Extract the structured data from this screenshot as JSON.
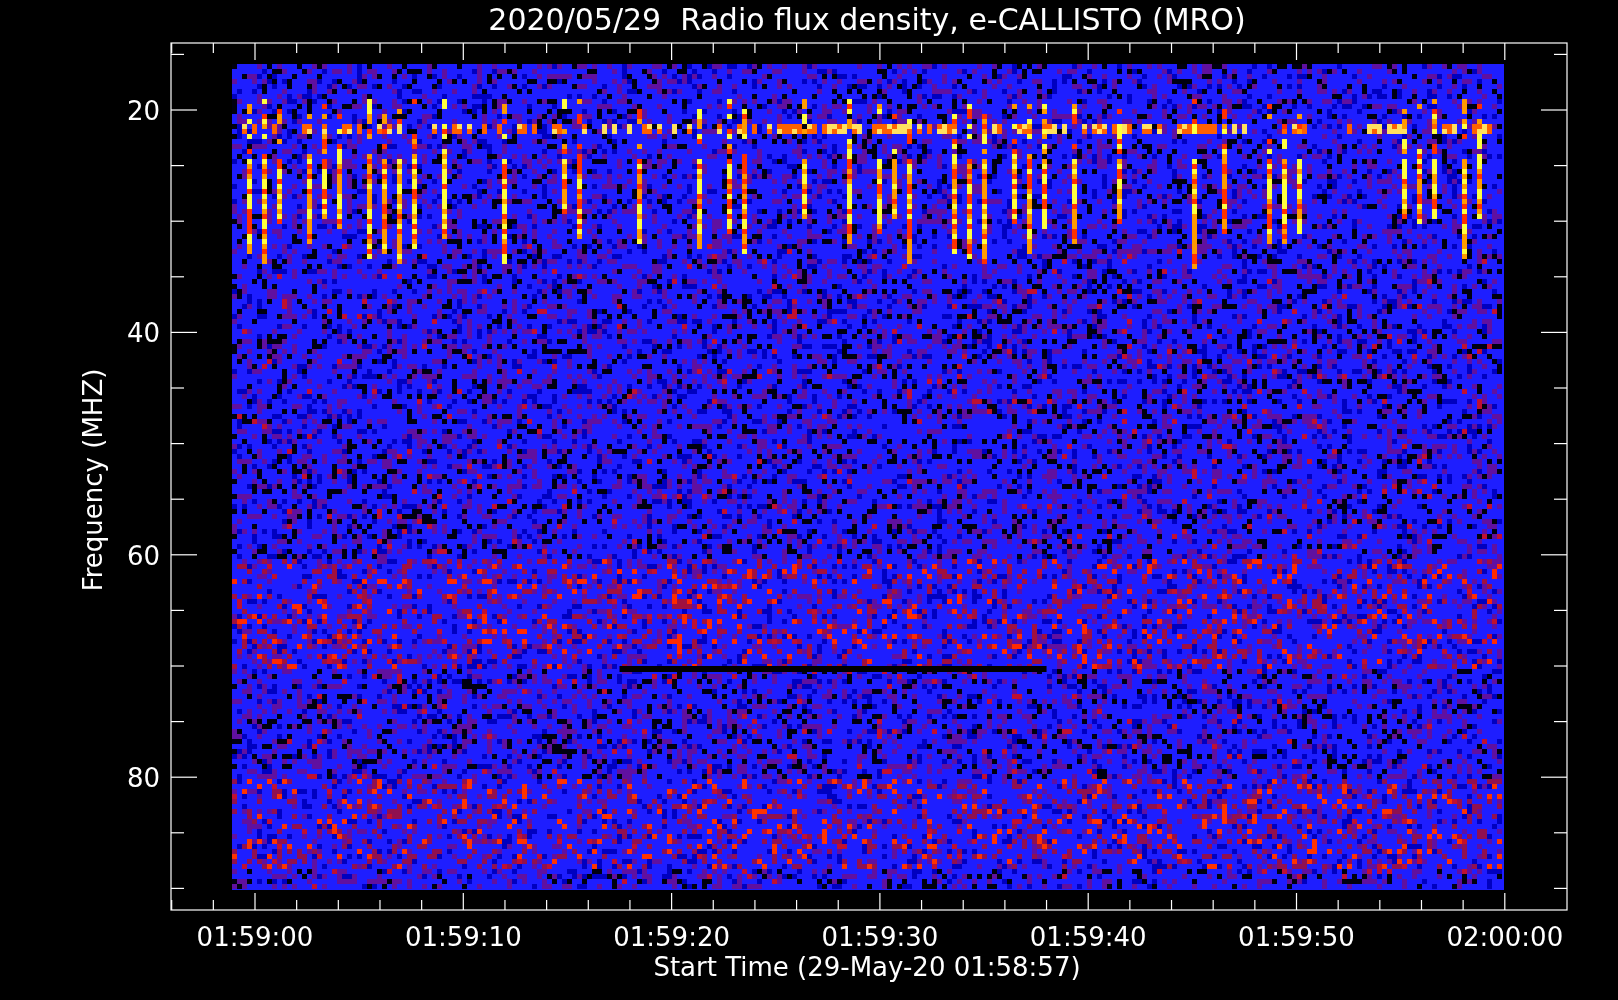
{
  "title": "2020/05/29  Radio flux density, e-CALLISTO (MRO)",
  "y_axis": {
    "label": "Frequency (MHZ)",
    "ticks": [
      "20",
      "40",
      "60",
      "80"
    ]
  },
  "x_axis": {
    "label": "Start Time (29-May-20 01:58:57)",
    "ticks": [
      "01:59:00",
      "01:59:10",
      "01:59:20",
      "01:59:30",
      "01:59:40",
      "01:59:50",
      "02:00:00"
    ]
  }
}
